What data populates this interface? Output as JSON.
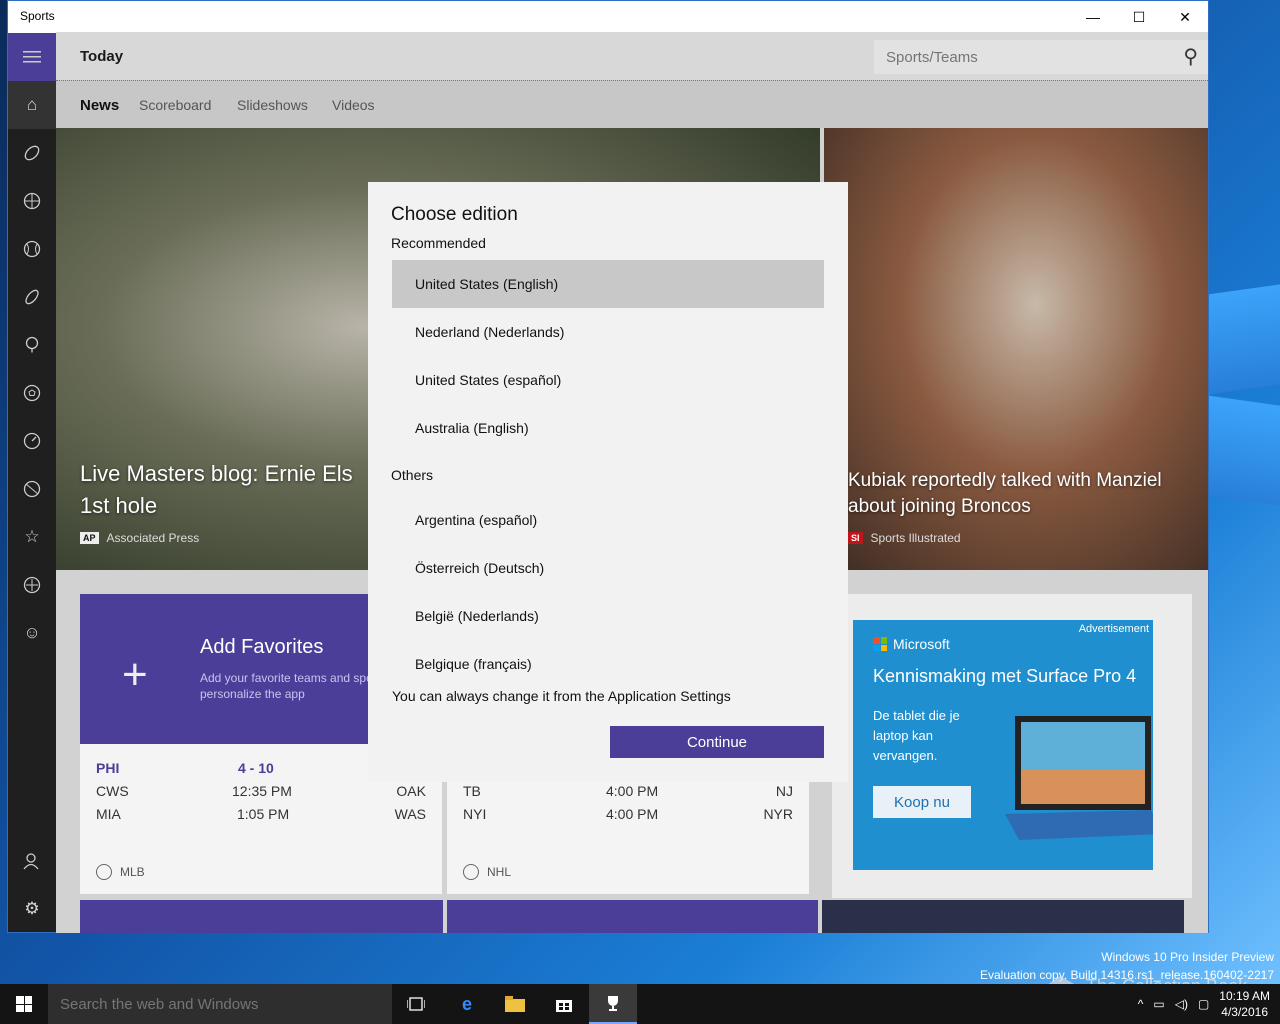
{
  "window": {
    "title": "Sports",
    "minimize_glyph": "—",
    "maximize_glyph": "☐",
    "close_glyph": "✕"
  },
  "header": {
    "title": "Today",
    "search_placeholder": "Sports/Teams"
  },
  "tabs": [
    "News",
    "Scoreboard",
    "Slideshows",
    "Videos"
  ],
  "rail": {
    "icons": [
      "hamburger-icon",
      "home-icon",
      "football-icon",
      "basketball-icon",
      "baseball-icon",
      "hockey-icon",
      "golf-icon",
      "soccer-icon",
      "racing-icon",
      "tennis-icon",
      "favorites-icon",
      "sports-list-icon",
      "smiley-icon",
      "account-icon",
      "settings-icon"
    ]
  },
  "hero": {
    "left_caption": "Live Masters blog: Ernie Els\n1st hole",
    "left_source_badge": "AP",
    "left_source": "Associated Press",
    "right_caption": "Kubiak reportedly talked with Manziel\nabout joining Broncos",
    "right_source_badge": "SI",
    "right_source": "Sports Illustrated"
  },
  "favorites": {
    "plus": "+",
    "title": "Add Favorites",
    "desc": "Add your favorite teams and sports to personalize the app"
  },
  "scores": {
    "mlb": {
      "rows": [
        {
          "home": "PHI",
          "score": "4  -  10",
          "away": ""
        },
        {
          "home": "CWS",
          "score": "12:35 PM",
          "away": "OAK"
        },
        {
          "home": "MIA",
          "score": "1:05 PM",
          "away": "WAS"
        }
      ],
      "league": "MLB"
    },
    "nhl": {
      "rows": [
        {
          "home": "TB",
          "score": "4:00 PM",
          "away": "NJ"
        },
        {
          "home": "NYI",
          "score": "4:00 PM",
          "away": "NYR"
        }
      ],
      "league": "NHL"
    }
  },
  "ad": {
    "label": "Advertisement",
    "brand": "Microsoft",
    "headline": "Kennismaking met Surface Pro 4",
    "body": "De tablet die je laptop kan vervangen.",
    "cta": "Koop nu"
  },
  "dialog": {
    "title": "Choose edition",
    "recommended_label": "Recommended",
    "recommended": [
      "United States (English)",
      "Nederland (Nederlands)",
      "United States (español)",
      "Australia (English)"
    ],
    "others_label": "Others",
    "others": [
      "Argentina (español)",
      "Österreich (Deutsch)",
      "België (Nederlands)",
      "Belgique (français)"
    ],
    "selected": "United States (English)",
    "note": "You can always change it from the Application Settings",
    "continue_label": "Continue"
  },
  "watermark": {
    "line1": "Windows 10 Pro Insider Preview",
    "line2": "Evaluation copy. Build 14316.rs1_release.160402-2217",
    "overlay_text": "The Collection Book"
  },
  "taskbar": {
    "search_placeholder": "Search the web and Windows",
    "time": "10:19 AM",
    "date": "4/3/2016"
  },
  "colors": {
    "accent": "#4a3e98",
    "ad_blue": "#1f8fcf"
  }
}
